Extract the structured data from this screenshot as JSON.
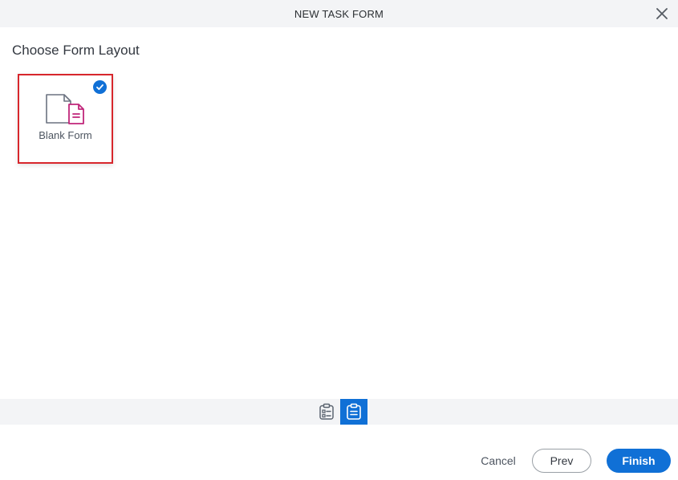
{
  "dialog": {
    "title": "NEW TASK FORM",
    "close_icon": "close-icon"
  },
  "main": {
    "heading": "Choose Form Layout",
    "layouts": [
      {
        "label": "Blank Form",
        "icon": "blank-form-icon",
        "selected": true
      }
    ]
  },
  "steps": [
    {
      "icon": "checklist-clipboard-icon",
      "active": false
    },
    {
      "icon": "form-clipboard-icon",
      "active": true
    }
  ],
  "footer": {
    "cancel_label": "Cancel",
    "prev_label": "Prev",
    "finish_label": "Finish"
  },
  "colors": {
    "accent": "#1070d6",
    "selection_border": "#d7262c",
    "form_icon": "#c0267a",
    "header_bg": "#f3f4f6"
  }
}
